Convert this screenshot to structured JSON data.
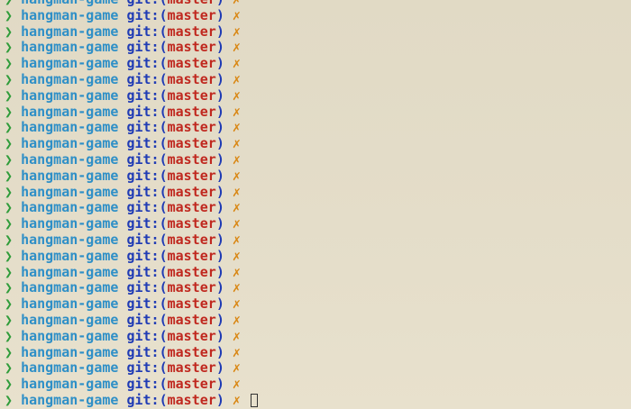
{
  "terminal": {
    "prompt_symbol": "❯",
    "directory": "hangman-game",
    "git_prefix": "git:",
    "git_open": "(",
    "branch": "master",
    "git_close": ")",
    "dirty_mark": "✗",
    "line_count": 26
  },
  "colors": {
    "background": "#e3dcc6",
    "prompt_symbol": "#2f9c3a",
    "directory": "#2e8fc7",
    "git_prefix": "#1f3bb5",
    "branch": "#c0281f",
    "dirty_mark": "#d9850f"
  }
}
